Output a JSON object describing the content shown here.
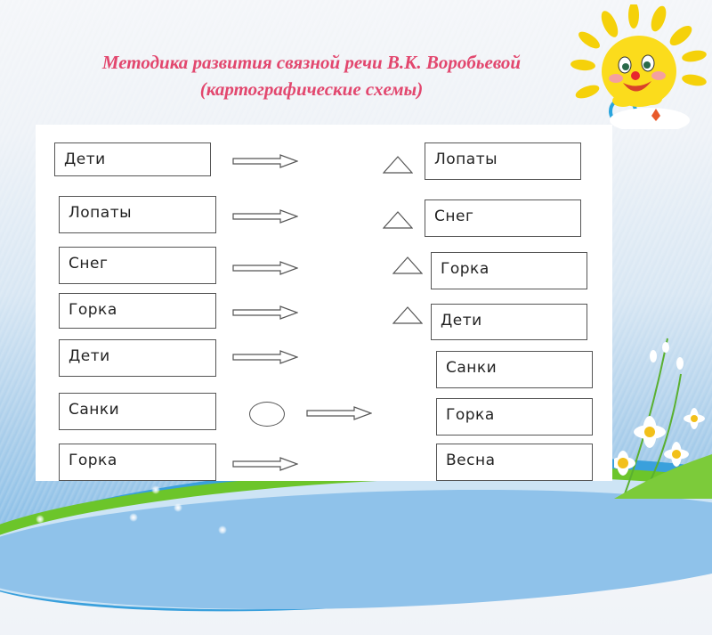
{
  "slide": {
    "title_line1": "Методика развития связной речи В.К. Воробьевой",
    "title_line2": "(картографические схемы)",
    "colors": {
      "title": "#e2476e",
      "box_border": "#555555",
      "panel": "#ffffff"
    }
  },
  "left_column": [
    {
      "label": "Дети",
      "connector": "arrow-icon"
    },
    {
      "label": "Лопаты",
      "connector": "arrow-icon"
    },
    {
      "label": "Снег",
      "connector": "arrow-icon"
    },
    {
      "label": "Горка",
      "connector": "arrow-icon"
    },
    {
      "label": "Дети",
      "connector": "arrow-icon"
    },
    {
      "label": "Санки",
      "connector": "circle-icon + arrow-icon"
    },
    {
      "label": "Горка",
      "connector": "arrow-icon"
    }
  ],
  "right_column": [
    {
      "label": "Лопаты",
      "marker": "triangle-icon"
    },
    {
      "label": "Снег",
      "marker": "triangle-icon"
    },
    {
      "label": "Горка",
      "marker": "triangle-icon"
    },
    {
      "label": "Дети",
      "marker": "triangle-icon"
    },
    {
      "label": "Санки",
      "marker": ""
    },
    {
      "label": "Горка",
      "marker": ""
    },
    {
      "label": "Весна",
      "marker": ""
    }
  ],
  "decorations": [
    "sun-character-icon",
    "daisy-flowers-icon"
  ]
}
